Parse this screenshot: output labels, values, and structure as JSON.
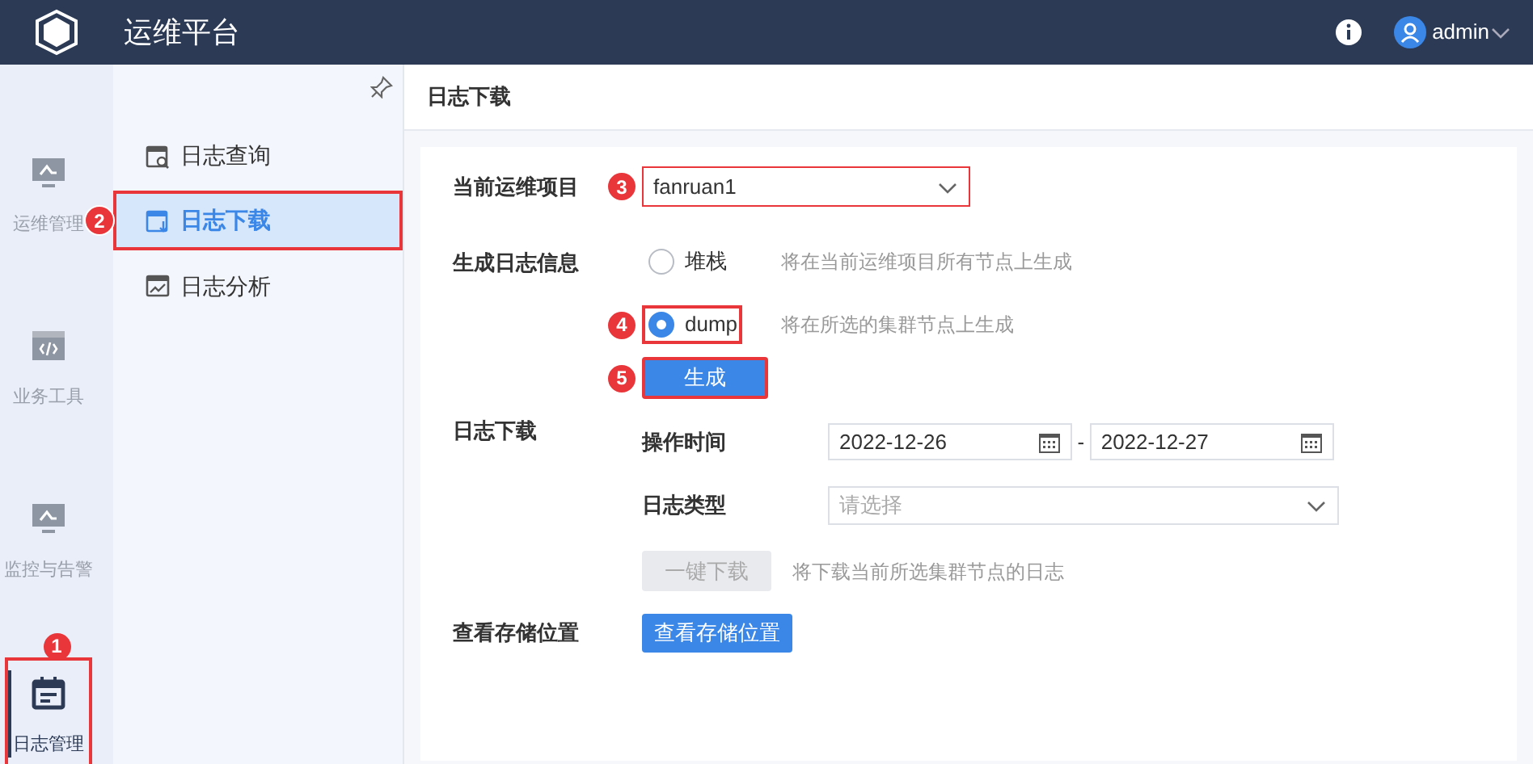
{
  "header": {
    "title": "运维平台",
    "user": "admin"
  },
  "rail": {
    "items": [
      {
        "label": "运维管理",
        "selected": false
      },
      {
        "label": "业务工具",
        "selected": false
      },
      {
        "label": "监控与告警",
        "selected": false
      },
      {
        "label": "日志管理",
        "selected": true,
        "callout": "1"
      }
    ]
  },
  "submenu": {
    "items": [
      {
        "label": "日志查询",
        "selected": false
      },
      {
        "label": "日志下载",
        "selected": true,
        "callout": "2"
      },
      {
        "label": "日志分析",
        "selected": false
      }
    ]
  },
  "page_title": "日志下载",
  "form": {
    "project": {
      "label": "当前运维项目",
      "value": "fanruan1",
      "callout": "3"
    },
    "generate": {
      "label": "生成日志信息",
      "options": [
        {
          "label": "堆栈",
          "description": "将在当前运维项目所有节点上生成",
          "selected": false
        },
        {
          "label": "dump",
          "description": "将在所选的集群节点上生成",
          "selected": true,
          "callout": "4"
        }
      ],
      "button": {
        "label": "生成",
        "callout": "5"
      }
    },
    "download": {
      "label": "日志下载",
      "time": {
        "label": "操作时间",
        "start": "2022-12-26",
        "separator": "-",
        "end": "2022-12-27"
      },
      "type": {
        "label": "日志类型",
        "placeholder": "请选择"
      },
      "button": {
        "label": "一键下载",
        "disabled": true
      },
      "description": "将下载当前所选集群节点的日志"
    },
    "storage": {
      "label": "查看存储位置",
      "button": {
        "label": "查看存储位置"
      }
    }
  }
}
